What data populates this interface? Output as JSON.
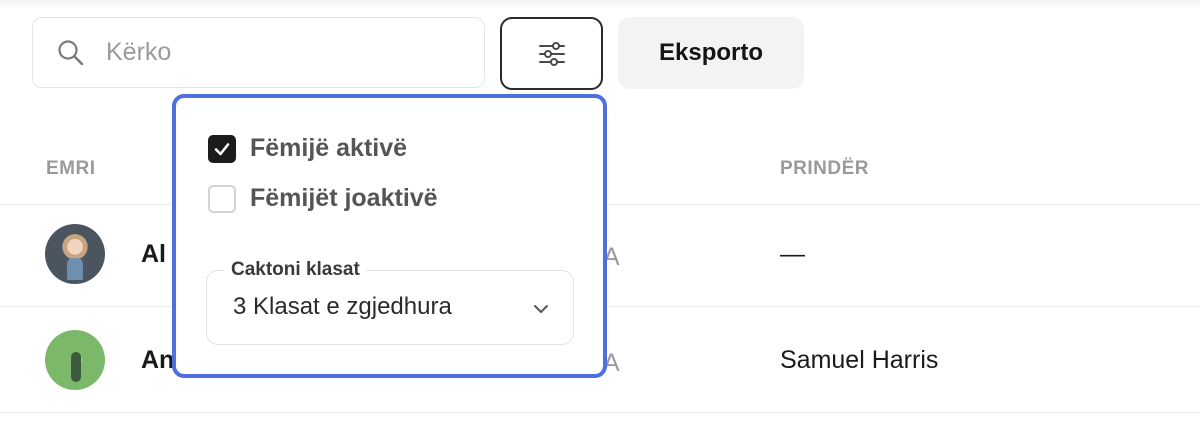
{
  "search": {
    "placeholder": "Kërko"
  },
  "toolbar": {
    "export_label": "Eksporto"
  },
  "table": {
    "columns": {
      "name": "EMRI",
      "parent": "PRINDËR"
    },
    "rows": [
      {
        "name": "Al",
        "mid": "A",
        "parent": "—"
      },
      {
        "name": "An",
        "mid": "A",
        "parent": "Samuel Harris"
      }
    ]
  },
  "filter_panel": {
    "active_label": "Fëmijë aktivë",
    "active_checked": true,
    "inactive_label": "Fëmijët joaktivë",
    "inactive_checked": false,
    "class_select_legend": "Caktoni klasat",
    "class_select_value": "3 Klasat e zgjedhura"
  },
  "colors": {
    "accent": "#4f6fe0",
    "muted": "#9a9a9a",
    "dark": "#1c1c1c"
  },
  "icons": [
    "search-icon",
    "sliders-icon",
    "check-icon",
    "chevron-down-icon"
  ]
}
